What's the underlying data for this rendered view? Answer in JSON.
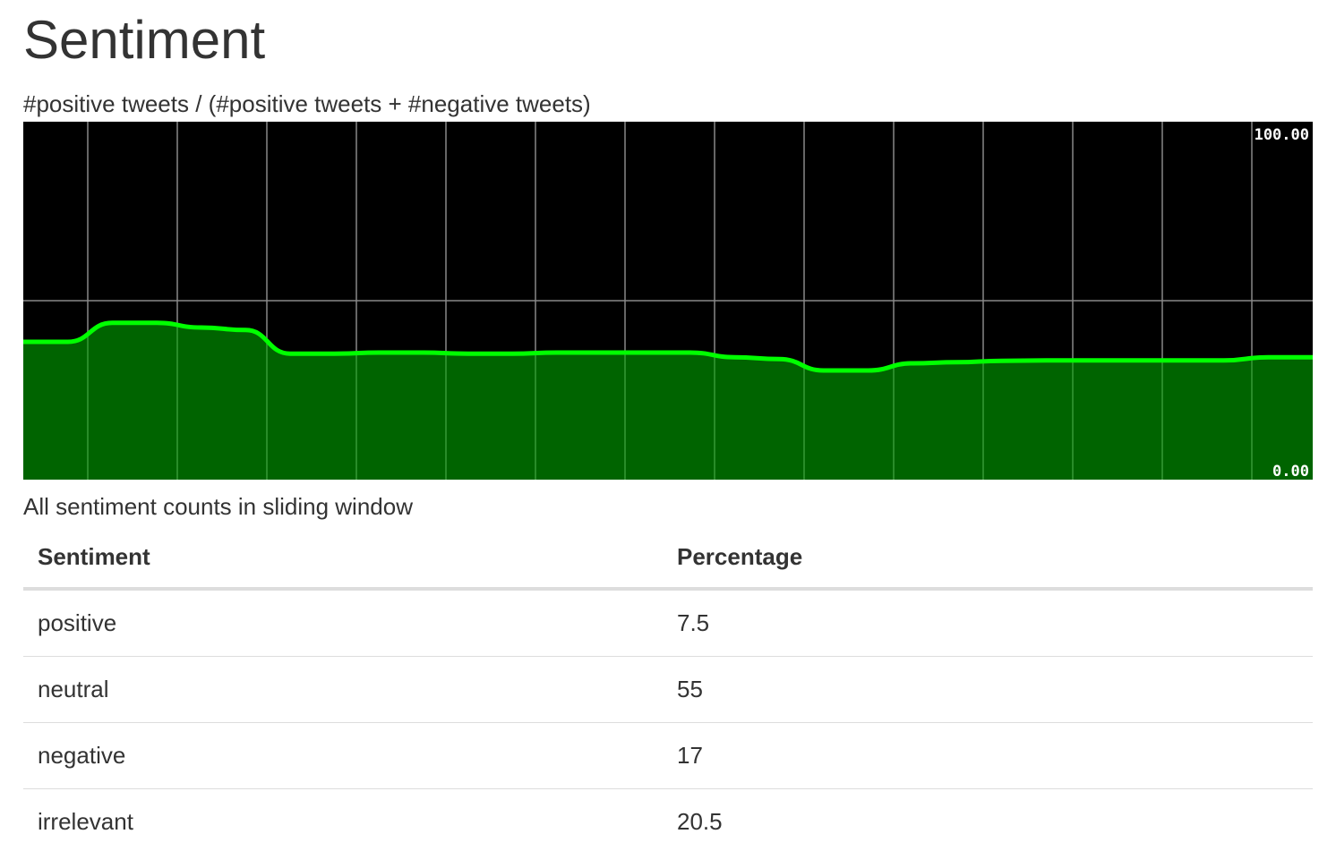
{
  "page": {
    "title": "Sentiment"
  },
  "chart_section": {
    "caption": "#positive tweets / (#positive tweets + #negative tweets)"
  },
  "chart_data": {
    "type": "area",
    "title": "",
    "xlabel": "",
    "ylabel": "",
    "ylim": [
      0,
      100
    ],
    "y_labels": {
      "max": "100.00",
      "min": "0.00"
    },
    "grid": true,
    "legend": "none",
    "colors": {
      "background": "#000000",
      "fill": "#006400",
      "line": "#00ff00",
      "grid": "#888888"
    },
    "x": [
      0,
      1,
      2,
      3,
      4,
      5,
      6,
      7,
      8,
      9,
      10,
      11,
      12,
      13,
      14,
      15,
      16,
      17,
      18,
      19,
      20,
      21,
      22,
      23,
      24,
      25,
      26,
      27,
      28,
      29
    ],
    "values": [
      38.5,
      38.5,
      43.8,
      43.8,
      42.5,
      41.8,
      35.2,
      35.2,
      35.5,
      35.5,
      35.2,
      35.2,
      35.5,
      35.5,
      35.5,
      35.5,
      34.2,
      33.7,
      30.5,
      30.5,
      32.5,
      32.8,
      33.2,
      33.3,
      33.3,
      33.3,
      33.3,
      33.3,
      34.2,
      34.2
    ]
  },
  "table_section": {
    "caption": "All sentiment counts in sliding window",
    "headers": [
      "Sentiment",
      "Percentage"
    ],
    "rows": [
      {
        "sentiment": "positive",
        "percentage": "7.5"
      },
      {
        "sentiment": "neutral",
        "percentage": "55"
      },
      {
        "sentiment": "negative",
        "percentage": "17"
      },
      {
        "sentiment": "irrelevant",
        "percentage": "20.5"
      }
    ]
  }
}
